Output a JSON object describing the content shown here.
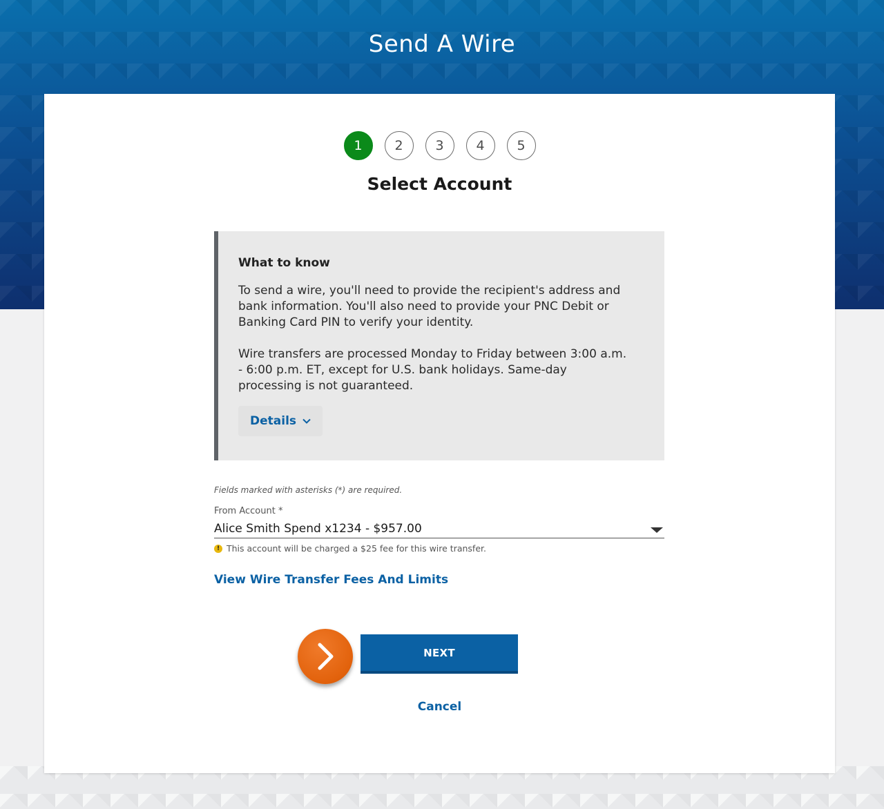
{
  "page": {
    "title": "Send A Wire"
  },
  "stepper": {
    "steps": [
      "1",
      "2",
      "3",
      "4",
      "5"
    ],
    "active_step": 1,
    "current_title": "Select Account"
  },
  "info": {
    "heading": "What to know",
    "paragraph_1": "To send a wire, you'll need to provide the recipient's address and bank information. You'll also need to provide your PNC Debit or Banking Card PIN to verify your identity.",
    "paragraph_2": "Wire transfers are processed Monday to Friday between 3:00 a.m. - 6:00 p.m. ET, except for U.S. bank holidays. Same-day processing is not guaranteed.",
    "details_label": "Details"
  },
  "form": {
    "required_note": "Fields marked with asterisks (*) are required.",
    "from_account_label": "From Account *",
    "from_account_value": "Alice Smith Spend x1234 - $957.00",
    "fee_warning": "This account will be charged a $25 fee for this wire transfer.",
    "warning_glyph": "!"
  },
  "links": {
    "fees_link": "View Wire Transfer Fees And Limits",
    "cancel": "Cancel"
  },
  "actions": {
    "next_label": "NEXT"
  },
  "colors": {
    "primary_blue": "#0b61a4",
    "active_step_green": "#0b8a1a",
    "orange_badge": "#e2620c",
    "warning_yellow": "#e8b80e"
  }
}
